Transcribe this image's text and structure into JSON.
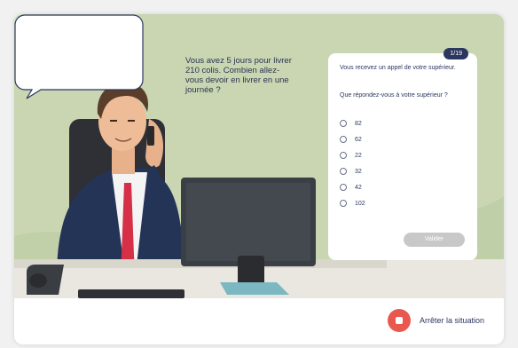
{
  "bubble": {
    "text": "Vous avez 5 jours pour livrer 210 colis. Combien allez-vous devoir en livrer en une journée ?"
  },
  "question": {
    "counter": "1/19",
    "intro": "Vous recevez un appel de votre supérieur.",
    "prompt": "Que répondez-vous à votre supérieur ?",
    "options": [
      "82",
      "62",
      "22",
      "32",
      "42",
      "102"
    ],
    "validate_label": "Valider"
  },
  "footer": {
    "stop_label": "Arrêter la situation"
  },
  "colors": {
    "background": "#c6d3ad",
    "accent_navy": "#2b3760",
    "stop_red": "#e8584e",
    "button_disabled": "#c8c8c8"
  }
}
